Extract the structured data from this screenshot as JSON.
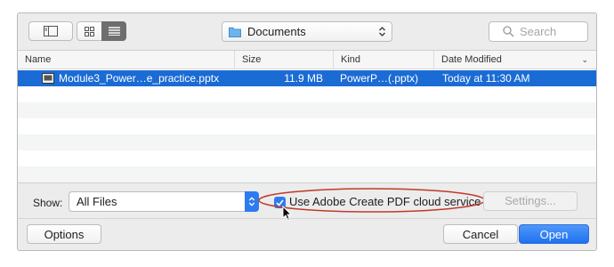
{
  "toolbar": {
    "sidebar_icon": "sidebar-icon",
    "view_icons_icon": "icon-view-grid-icon",
    "view_list_icon": "list-view-icon",
    "location": "Documents",
    "search_placeholder": "Search"
  },
  "columns": {
    "name": "Name",
    "size": "Size",
    "kind": "Kind",
    "date": "Date Modified"
  },
  "files": [
    {
      "name": "Module3_Power…e_practice.pptx",
      "size": "11.9 MB",
      "kind": "PowerP…(.pptx)",
      "date": "Today at 11:30 AM",
      "selected": true
    }
  ],
  "options": {
    "show_label": "Show:",
    "show_value": "All Files",
    "checkbox_label": "Use Adobe Create PDF cloud service",
    "checkbox_checked": true,
    "settings_label": "Settings..."
  },
  "buttons": {
    "options": "Options",
    "cancel": "Cancel",
    "open": "Open"
  },
  "colors": {
    "selection": "#1b6bd5",
    "accent": "#2e7bf0",
    "annotation": "#c0392b"
  }
}
